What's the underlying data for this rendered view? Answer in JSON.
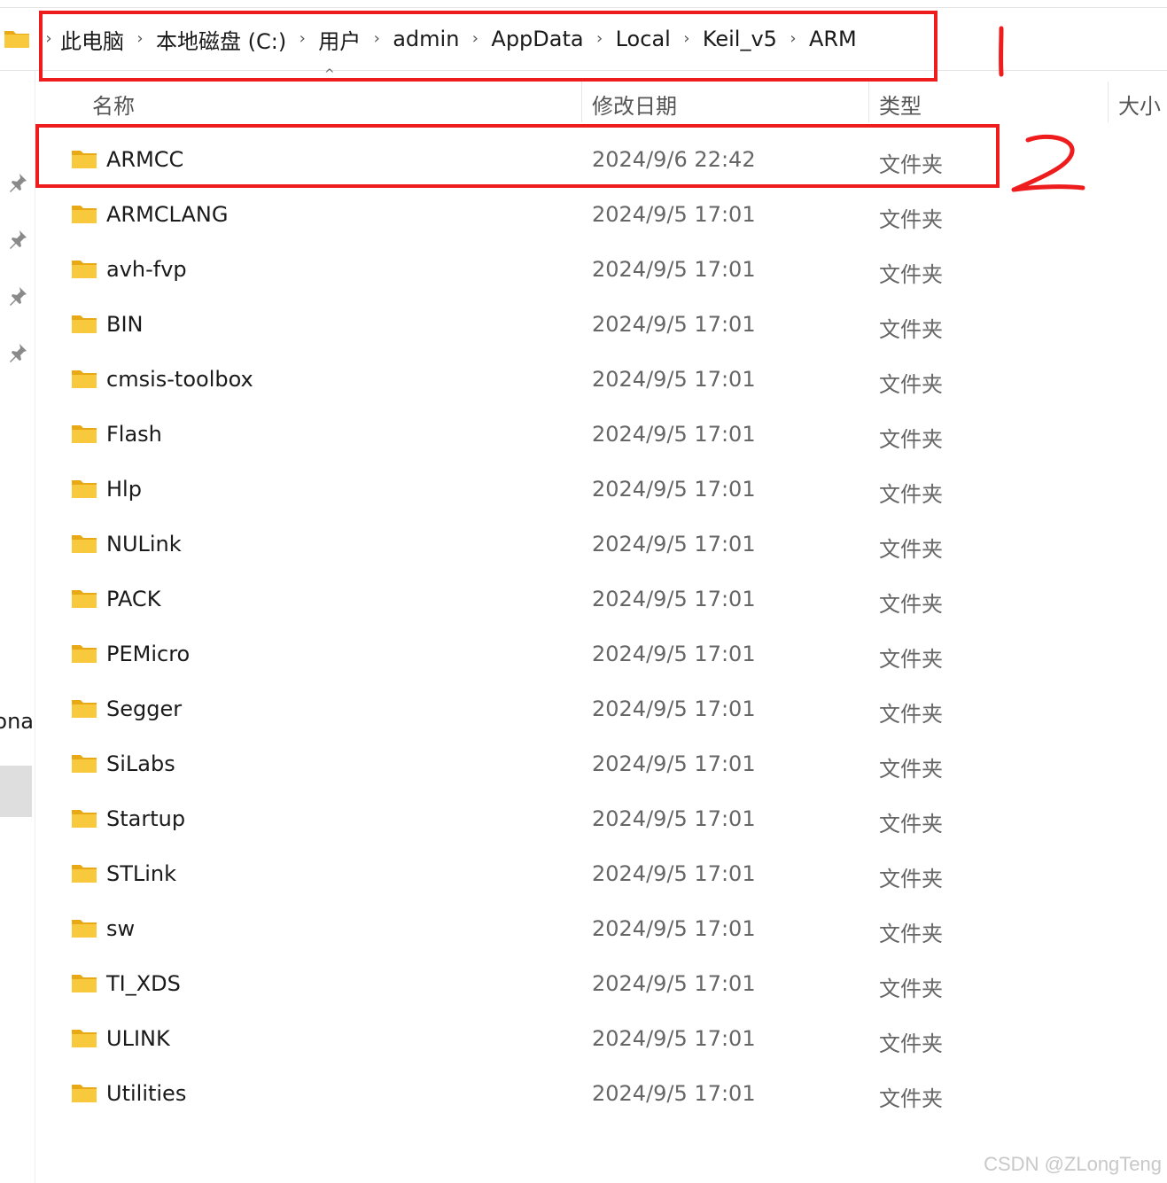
{
  "breadcrumb": [
    "此电脑",
    "本地磁盘 (C:)",
    "用户",
    "admin",
    "AppData",
    "Local",
    "Keil_v5",
    "ARM"
  ],
  "breadcrumb_separator": "›",
  "sort_caret": "^",
  "nav_partial_label": "ona",
  "columns": {
    "name": "名称",
    "date": "修改日期",
    "type": "类型",
    "size": "大小"
  },
  "files": [
    {
      "name": "ARMCC",
      "date": "2024/9/6 22:42",
      "type": "文件夹"
    },
    {
      "name": "ARMCLANG",
      "date": "2024/9/5 17:01",
      "type": "文件夹"
    },
    {
      "name": "avh-fvp",
      "date": "2024/9/5 17:01",
      "type": "文件夹"
    },
    {
      "name": "BIN",
      "date": "2024/9/5 17:01",
      "type": "文件夹"
    },
    {
      "name": "cmsis-toolbox",
      "date": "2024/9/5 17:01",
      "type": "文件夹"
    },
    {
      "name": "Flash",
      "date": "2024/9/5 17:01",
      "type": "文件夹"
    },
    {
      "name": "Hlp",
      "date": "2024/9/5 17:01",
      "type": "文件夹"
    },
    {
      "name": "NULink",
      "date": "2024/9/5 17:01",
      "type": "文件夹"
    },
    {
      "name": "PACK",
      "date": "2024/9/5 17:01",
      "type": "文件夹"
    },
    {
      "name": "PEMicro",
      "date": "2024/9/5 17:01",
      "type": "文件夹"
    },
    {
      "name": "Segger",
      "date": "2024/9/5 17:01",
      "type": "文件夹"
    },
    {
      "name": "SiLabs",
      "date": "2024/9/5 17:01",
      "type": "文件夹"
    },
    {
      "name": "Startup",
      "date": "2024/9/5 17:01",
      "type": "文件夹"
    },
    {
      "name": "STLink",
      "date": "2024/9/5 17:01",
      "type": "文件夹"
    },
    {
      "name": "sw",
      "date": "2024/9/5 17:01",
      "type": "文件夹"
    },
    {
      "name": "TI_XDS",
      "date": "2024/9/5 17:01",
      "type": "文件夹"
    },
    {
      "name": "ULINK",
      "date": "2024/9/5 17:01",
      "type": "文件夹"
    },
    {
      "name": "Utilities",
      "date": "2024/9/5 17:01",
      "type": "文件夹"
    }
  ],
  "annotations": {
    "step1": "1",
    "step2": "2",
    "color": "#ee1c1c"
  },
  "watermark": "CSDN @ZLongTeng",
  "colors": {
    "folder_yellow": "#f8c93c",
    "folder_dark": "#e8a915",
    "annotation_red": "#ee1c1c"
  }
}
